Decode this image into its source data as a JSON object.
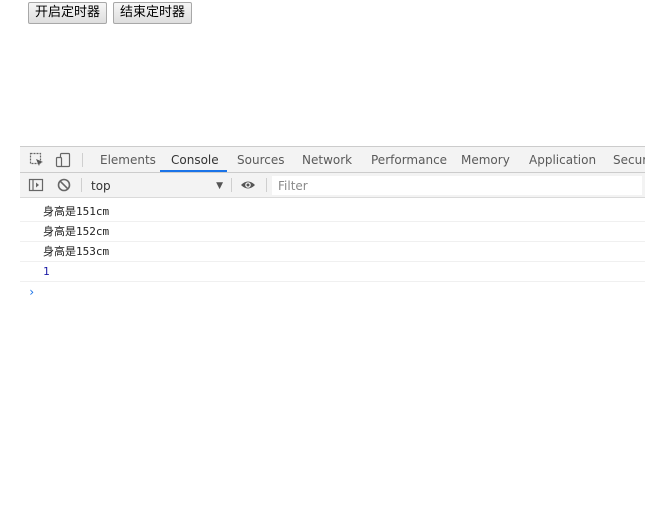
{
  "page": {
    "start_button": "开启定时器",
    "stop_button": "结束定时器"
  },
  "devtools": {
    "tabs": [
      {
        "label": "Elements"
      },
      {
        "label": "Console",
        "active": true
      },
      {
        "label": "Sources"
      },
      {
        "label": "Network"
      },
      {
        "label": "Performance"
      },
      {
        "label": "Memory"
      },
      {
        "label": "Application"
      },
      {
        "label": "Securi"
      }
    ],
    "toolbar": {
      "context": "top",
      "filter_placeholder": "Filter"
    },
    "console": {
      "logs": [
        "身高是151cm",
        "身高是152cm",
        "身高是153cm"
      ],
      "return_value": "1",
      "prompt": "›"
    },
    "accent_color": "#1a73e8"
  }
}
